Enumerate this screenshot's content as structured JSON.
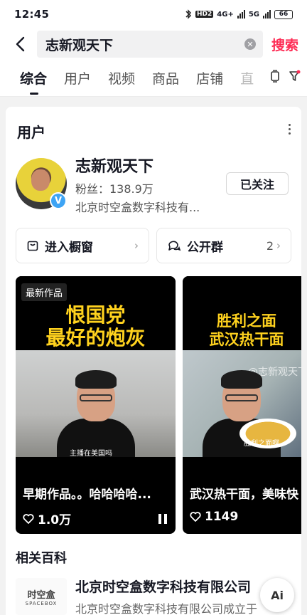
{
  "status_bar": {
    "time": "12:45",
    "hd": "HD2",
    "net1": "4G+",
    "net2": "5G",
    "battery": "66"
  },
  "search": {
    "query": "志新观天下",
    "submit_label": "搜索"
  },
  "tabs": [
    {
      "label": "综合",
      "active": true
    },
    {
      "label": "用户"
    },
    {
      "label": "视频"
    },
    {
      "label": "商品"
    },
    {
      "label": "店铺"
    },
    {
      "label": "直"
    }
  ],
  "users_section": {
    "title": "用户",
    "user": {
      "name": "志新观天下",
      "fans": "粉丝：138.9万",
      "org": "北京时空盒数字科技有...",
      "follow_label": "已关注"
    },
    "actions": [
      {
        "label": "进入橱窗",
        "icon": "bag-icon"
      },
      {
        "label": "公开群",
        "icon": "chat-group-icon",
        "count": "2"
      }
    ]
  },
  "videos": [
    {
      "badge": "最新作品",
      "headline_lines": [
        "恨国党",
        "最好的炮灰"
      ],
      "subtitle": "主播在美国吗",
      "caption": "早期作品。。哈哈哈哈...",
      "likes": "1.0万"
    },
    {
      "headline_lines": [
        "胜利之面",
        "武汉热干面"
      ],
      "watermark": "@志新观天下",
      "plate_label": "胜利之面啊",
      "caption": "武汉热干面，美味快",
      "likes": "1149"
    }
  ],
  "baike": {
    "title": "相关百科",
    "logo_line1": "时空盒",
    "logo_line2": "SPACEBOX",
    "name": "北京时空盒数字科技有限公司",
    "desc": "北京时空盒数字科技有限公司成立于"
  },
  "ai_button": "Ai",
  "colors": {
    "accent": "#fe2c55",
    "headline": "#ffd21e",
    "verified": "#3da4f5"
  }
}
